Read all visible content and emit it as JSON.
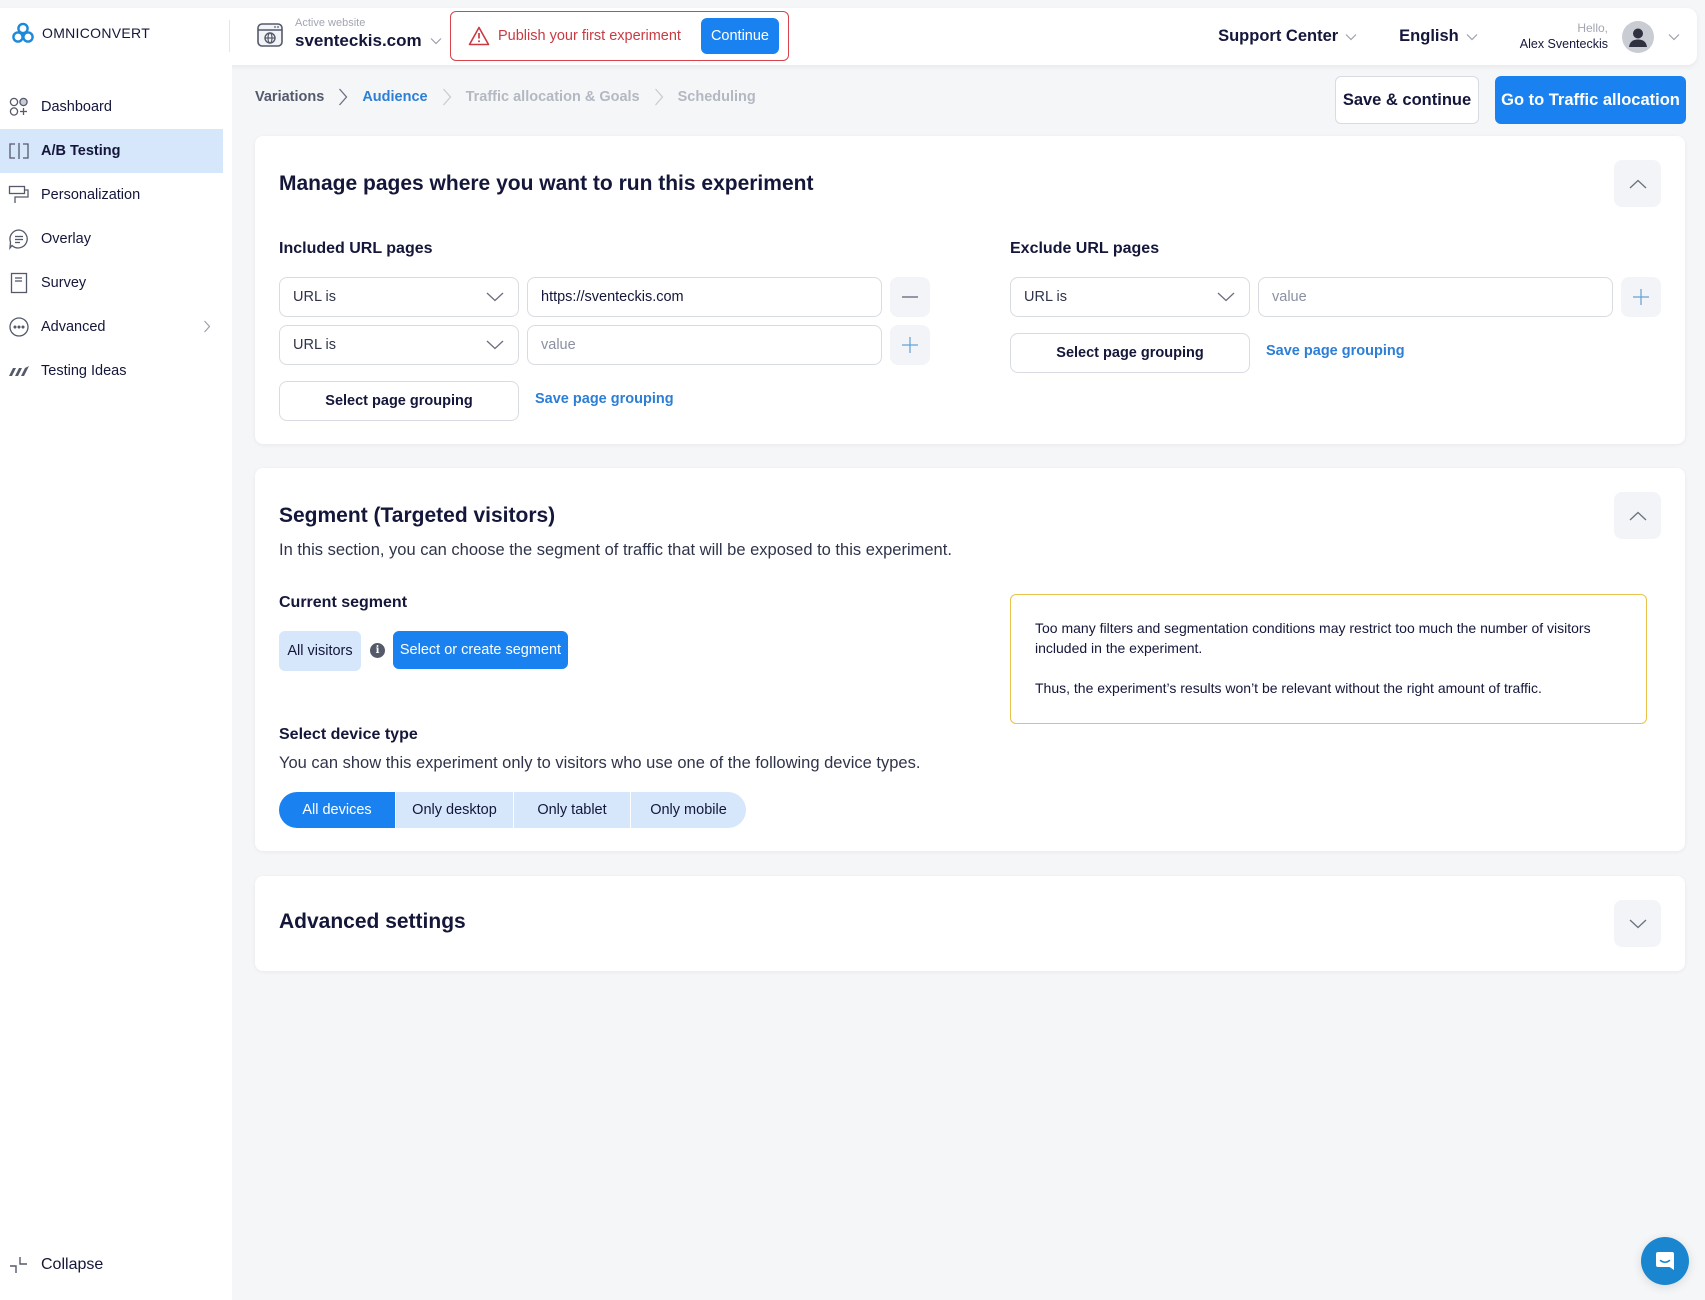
{
  "header": {
    "brand": "OMNICONVERT",
    "active_website_label": "Active website",
    "active_website": "sventeckis.com",
    "alert_text": "Publish your first experiment",
    "alert_button": "Continue",
    "support_center": "Support Center",
    "language": "English",
    "greeting": "Hello,",
    "user_name": "Alex Sventeckis"
  },
  "sidebar": {
    "items": [
      {
        "label": "Dashboard",
        "icon": "dashboard-icon",
        "active": false
      },
      {
        "label": "A/B Testing",
        "icon": "ab-testing-icon",
        "active": true
      },
      {
        "label": "Personalization",
        "icon": "personalization-icon",
        "active": false
      },
      {
        "label": "Overlay",
        "icon": "overlay-icon",
        "active": false
      },
      {
        "label": "Survey",
        "icon": "survey-icon",
        "active": false
      },
      {
        "label": "Advanced",
        "icon": "advanced-icon",
        "active": false,
        "has_submenu": true
      },
      {
        "label": "Testing Ideas",
        "icon": "testing-ideas-icon",
        "active": false
      }
    ],
    "collapse_label": "Collapse"
  },
  "breadcrumb": {
    "steps": [
      {
        "label": "Variations",
        "state": "done"
      },
      {
        "label": "Audience",
        "state": "active"
      },
      {
        "label": "Traffic allocation & Goals",
        "state": "future"
      },
      {
        "label": "Scheduling",
        "state": "future"
      }
    ]
  },
  "actions": {
    "save_continue": "Save & continue",
    "go_next": "Go to Traffic allocation"
  },
  "pages_card": {
    "title": "Manage pages where you want to run this experiment",
    "included": {
      "title": "Included URL pages",
      "rows": [
        {
          "condition": "URL is",
          "value": "https://sventeckis.com",
          "placeholder": "value",
          "action": "remove"
        },
        {
          "condition": "URL is",
          "value": "",
          "placeholder": "value",
          "action": "add"
        }
      ],
      "select_grouping": "Select page grouping",
      "save_grouping": "Save page grouping"
    },
    "excluded": {
      "title": "Exclude URL pages",
      "rows": [
        {
          "condition": "URL is",
          "value": "",
          "placeholder": "value",
          "action": "add"
        }
      ],
      "select_grouping": "Select page grouping",
      "save_grouping": "Save page grouping"
    }
  },
  "segment_card": {
    "title": "Segment (Targeted visitors)",
    "description": "In this section, you can choose the segment of traffic that will be exposed to this experiment.",
    "current_segment_label": "Current segment",
    "current_segment": "All visitors",
    "info_glyph": "i",
    "select_segment_button": "Select or create segment",
    "warning_lines": [
      "Too many filters and segmentation conditions may restrict too much the number of visitors included in the experiment.",
      "Thus, the experiment’s results won’t be relevant without the right amount of traffic."
    ],
    "device_title": "Select device type",
    "device_description": "You can show this experiment only to visitors who use one of the following device types.",
    "device_options": [
      {
        "label": "All devices",
        "selected": true
      },
      {
        "label": "Only desktop",
        "selected": false
      },
      {
        "label": "Only tablet",
        "selected": false
      },
      {
        "label": "Only mobile",
        "selected": false
      }
    ]
  },
  "advanced_card": {
    "title": "Advanced settings"
  },
  "colors": {
    "primary": "#1a82f0",
    "link": "#2c7ed6",
    "alert": "#c93a43",
    "warning_border": "#e9c24c",
    "active_nav_bg": "#d6e6fb",
    "text": "#14163a"
  }
}
